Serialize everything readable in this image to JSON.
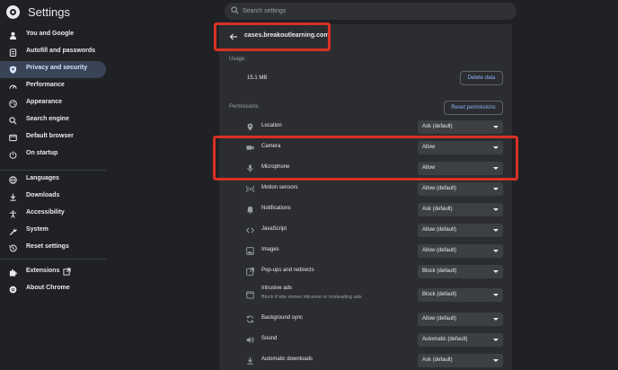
{
  "header": {
    "title": "Settings",
    "search_placeholder": "Search settings"
  },
  "sidebar": {
    "items": [
      {
        "label": "You and Google",
        "icon": "person-icon"
      },
      {
        "label": "Autofill and passwords",
        "icon": "clipboard-icon"
      },
      {
        "label": "Privacy and security",
        "icon": "shield-icon",
        "active": true
      },
      {
        "label": "Performance",
        "icon": "speedometer-icon"
      },
      {
        "label": "Appearance",
        "icon": "palette-icon"
      },
      {
        "label": "Search engine",
        "icon": "search-icon"
      },
      {
        "label": "Default browser",
        "icon": "browser-icon"
      },
      {
        "label": "On startup",
        "icon": "power-icon"
      },
      {
        "label": "Languages",
        "icon": "globe-icon"
      },
      {
        "label": "Downloads",
        "icon": "download-icon"
      },
      {
        "label": "Accessibility",
        "icon": "accessibility-icon"
      },
      {
        "label": "System",
        "icon": "wrench-icon"
      },
      {
        "label": "Reset settings",
        "icon": "history-icon"
      },
      {
        "label": "Extensions",
        "icon": "puzzle-icon"
      },
      {
        "label": "About Chrome",
        "icon": "chrome-icon"
      }
    ]
  },
  "site": {
    "name": "cases.breakoutlearning.com"
  },
  "usage": {
    "label": "Usage",
    "size": "15.1 MB",
    "delete_label": "Delete data"
  },
  "permissions": {
    "label": "Permissions",
    "reset_label": "Reset permissions",
    "items": [
      {
        "label": "Location",
        "value": "Ask (default)",
        "icon": "location-icon"
      },
      {
        "label": "Camera",
        "value": "Allow",
        "icon": "camera-icon"
      },
      {
        "label": "Microphone",
        "value": "Allow",
        "icon": "microphone-icon"
      },
      {
        "label": "Motion sensors",
        "value": "Allow (default)",
        "icon": "sensors-icon"
      },
      {
        "label": "Notifications",
        "value": "Ask (default)",
        "icon": "bell-icon"
      },
      {
        "label": "JavaScript",
        "value": "Allow (default)",
        "icon": "code-icon"
      },
      {
        "label": "Images",
        "value": "Allow (default)",
        "icon": "image-icon"
      },
      {
        "label": "Pop-ups and redirects",
        "value": "Block (default)",
        "icon": "popup-icon"
      },
      {
        "label": "Intrusive ads",
        "sublabel": "Block if site shows intrusive or misleading ads",
        "value": "Block (default)",
        "icon": "ads-icon"
      },
      {
        "label": "Background sync",
        "value": "Allow (default)",
        "icon": "sync-icon"
      },
      {
        "label": "Sound",
        "value": "Automatic (default)",
        "icon": "sound-icon"
      },
      {
        "label": "Automatic downloads",
        "value": "Ask (default)",
        "icon": "download-icon"
      }
    ]
  },
  "colors": {
    "background": "#202124",
    "panel": "#2c2d30",
    "active_nav": "#394457",
    "accent": "#8ab4f8",
    "highlight": "#d93025"
  }
}
